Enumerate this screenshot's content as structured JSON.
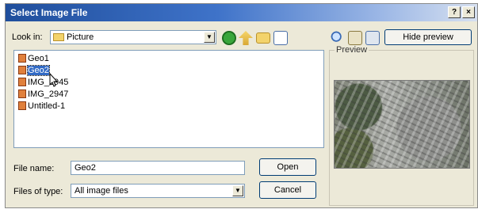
{
  "window": {
    "title": "Select Image File",
    "help_btn": "?",
    "close_btn": "×"
  },
  "lookin": {
    "label": "Look in:",
    "value": "Picture"
  },
  "toolbar": {
    "hide_preview_label": "Hide preview"
  },
  "files": [
    {
      "name": "Geo1",
      "selected": false
    },
    {
      "name": "Geo2",
      "selected": true
    },
    {
      "name": "IMG_2945",
      "selected": false
    },
    {
      "name": "IMG_2947",
      "selected": false
    },
    {
      "name": "Untitled-1",
      "selected": false
    }
  ],
  "filename": {
    "label": "File name:",
    "value": "Geo2"
  },
  "filetype": {
    "label": "Files of type:",
    "value": "All image files"
  },
  "buttons": {
    "open": "Open",
    "cancel": "Cancel"
  },
  "preview": {
    "label": "Preview"
  },
  "icons": {
    "back": "back-icon",
    "up": "up-folder-icon",
    "new_folder": "new-folder-icon",
    "view": "view-menu-icon",
    "zoom": "zoom-icon",
    "crop": "crop-icon",
    "thumbs": "thumbnails-icon"
  }
}
